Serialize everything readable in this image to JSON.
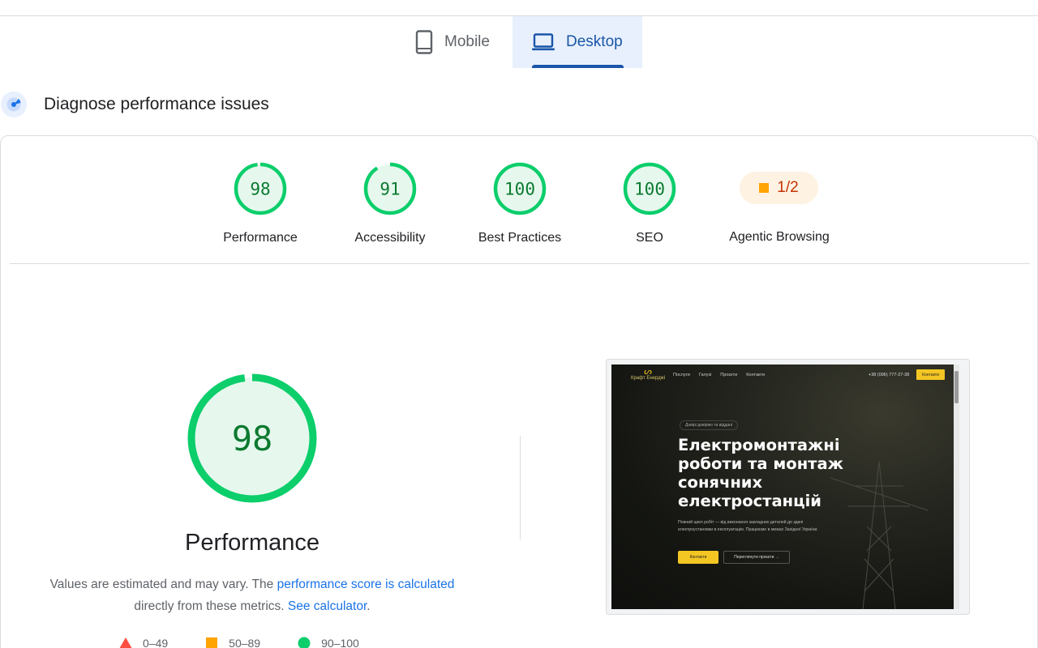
{
  "tabs": {
    "mobile_label": "Mobile",
    "desktop_label": "Desktop",
    "active": "Desktop"
  },
  "diagnose": {
    "title": "Diagnose performance issues"
  },
  "scores": [
    {
      "label": "Performance",
      "value": "98",
      "fraction": 0.98
    },
    {
      "label": "Accessibility",
      "value": "91",
      "fraction": 0.91
    },
    {
      "label": "Best Practices",
      "value": "100",
      "fraction": 1.0
    },
    {
      "label": "SEO",
      "value": "100",
      "fraction": 1.0
    }
  ],
  "agentic": {
    "label": "Agentic Browsing",
    "value": "1/2"
  },
  "performance": {
    "score": "98",
    "fraction": 0.98,
    "title": "Performance",
    "desc_prefix": "Values are estimated and may vary. The ",
    "desc_link1": "performance score is calculated",
    "desc_middle": "directly from these metrics.",
    "desc_link2": "See calculator",
    "desc_suffix": "."
  },
  "legend": [
    {
      "range": "0–49",
      "shape": "triangle",
      "color": "#ff4e42"
    },
    {
      "range": "50–89",
      "shape": "square",
      "color": "#ffa400"
    },
    {
      "range": "90–100",
      "shape": "circle",
      "color": "#0cce6b"
    }
  ],
  "screenshot": {
    "logo": "Крафт Енерджі",
    "nav": [
      "Послуги",
      "Галузі",
      "Проєкти",
      "Контакти"
    ],
    "phone": "+38 (096) 777-27-38",
    "nav_button": "Контакти",
    "badge": "Довірі довіряю та віддані",
    "headline": "Електромонтажні роботи та монтаж сонячних електростанцій",
    "subtext": "Повний цикл робіт — від виконання закладних деталей до здачі електроустановки в експлуатацію. Працюємо в межах Західної України.",
    "cta_primary": "Контакти",
    "cta_secondary": "Переглянути проєкти →"
  },
  "colors": {
    "good": "#0cce6b",
    "good_text": "#0c7a2f",
    "good_fill": "#e6f8ee",
    "accent": "#1a56a8",
    "link": "#1a73e8"
  }
}
